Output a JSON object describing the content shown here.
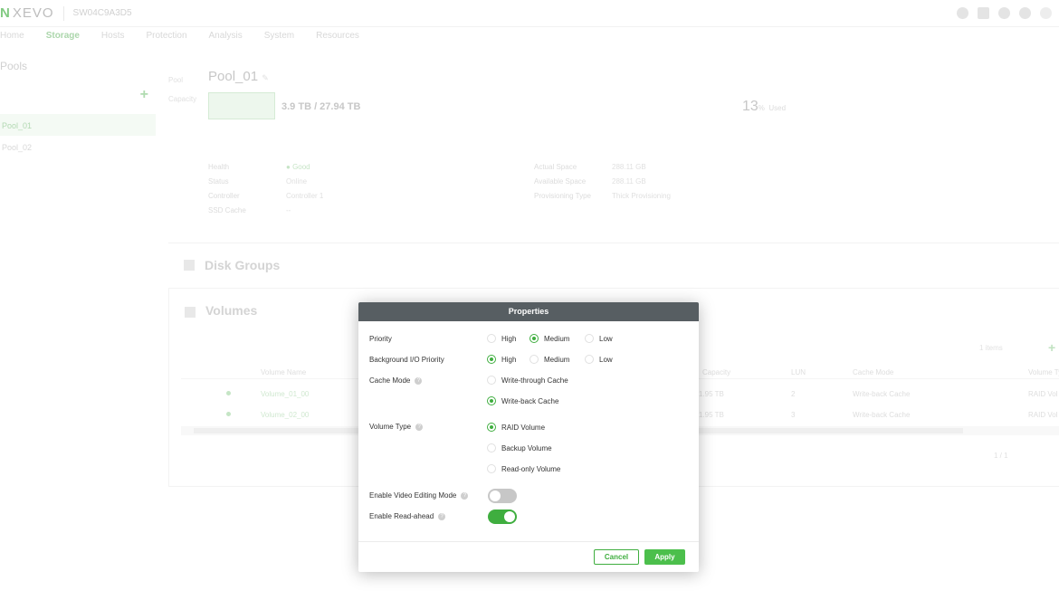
{
  "app": {
    "logo_mark": "N",
    "logo_text": "XEVO",
    "device_name": "SW04C9A3D5"
  },
  "nav": {
    "items": [
      "Home",
      "Storage",
      "Hosts",
      "Protection",
      "Analysis",
      "System",
      "Resources"
    ],
    "active": "Storage"
  },
  "pools": {
    "title": "Pools",
    "add": "+",
    "items": [
      "Pool_01",
      "Pool_02"
    ]
  },
  "pool_detail": {
    "label": "Pool",
    "name": "Pool_01",
    "capacity_label": "Capacity",
    "capacity_text": "3.9 TB / 27.94 TB",
    "used_percent": "13",
    "used_unit": "%",
    "used_label": "Used",
    "info_left": [
      {
        "key": "Health",
        "value": "Good"
      },
      {
        "key": "Status",
        "value": "Online"
      },
      {
        "key": "Controller",
        "value": "Controller 1"
      },
      {
        "key": "SSD Cache",
        "value": "--"
      }
    ],
    "info_right": [
      {
        "key": "Actual Space",
        "value": "288.11 GB"
      },
      {
        "key": "Available Space",
        "value": "288.11 GB"
      },
      {
        "key": "Provisioning Type",
        "value": "Thick Provisioning"
      }
    ]
  },
  "sections": {
    "disk_groups": "Disk Groups",
    "volumes": "Volumes"
  },
  "volumes_table": {
    "tools": "1 items",
    "add": "+",
    "columns": [
      "Volume Name",
      "Capacity",
      "LUN",
      "Cache Mode",
      "Volume Type"
    ],
    "rows": [
      {
        "name": "Volume_01_00",
        "capacity": "1.95 TB",
        "lun": "2",
        "cache": "Write-back Cache",
        "type": "RAID Vol"
      },
      {
        "name": "Volume_02_00",
        "capacity": "1.95 TB",
        "lun": "3",
        "cache": "Write-back Cache",
        "type": "RAID Vol"
      }
    ],
    "pager": "1 / 1"
  },
  "dialog": {
    "title": "Properties",
    "priority": {
      "label": "Priority",
      "options": [
        "High",
        "Medium",
        "Low"
      ],
      "selected": "Medium"
    },
    "bg_priority": {
      "label": "Background I/O Priority",
      "options": [
        "High",
        "Medium",
        "Low"
      ],
      "selected": "High"
    },
    "cache_mode": {
      "label": "Cache Mode",
      "options": [
        "Write-through Cache",
        "Write-back Cache"
      ],
      "selected": "Write-back Cache"
    },
    "volume_type": {
      "label": "Volume Type",
      "options": [
        "RAID Volume",
        "Backup Volume",
        "Read-only Volume"
      ],
      "selected": "RAID Volume"
    },
    "video_editing": {
      "label": "Enable Video Editing Mode",
      "enabled": false
    },
    "read_ahead": {
      "label": "Enable Read-ahead",
      "enabled": true
    },
    "help_glyph": "?",
    "cancel_label": "Cancel",
    "apply_label": "Apply"
  },
  "colors": {
    "accent": "#3fae3f",
    "dialog_header": "#575e62"
  }
}
